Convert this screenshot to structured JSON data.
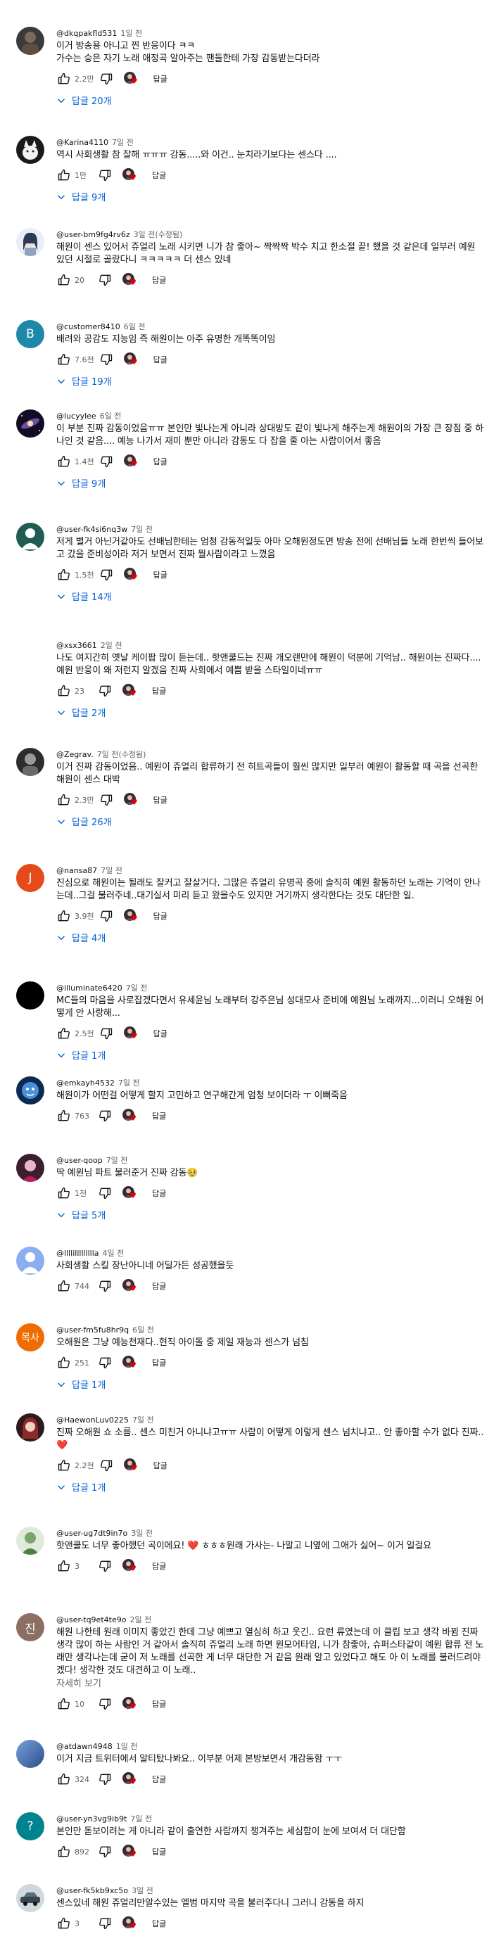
{
  "ui": {
    "reply_label": "답글",
    "read_more_label": "자세히 보기",
    "heart_glyph": "♥",
    "accent_color": "#065fd4",
    "heart_color": "#e00000"
  },
  "comments": [
    {
      "author": "@dkqpakfld531",
      "time": "1일 전",
      "text": "이거 방송용 아니고 찐 반응이다 ㅋㅋ\n가수는 승은 자기 노래 애정곡 알아주는 팬들한테 가장 감동받는다더라",
      "likes": "2.2만",
      "replies": "답글 20개",
      "avatar": "img:dark-photo"
    },
    {
      "author": "@Karina4110",
      "time": "7일 전",
      "text": "역시 사회생활 참 잘해 ㅠㅠㅠ 감동.....와 이건.. 눈치라기보다는 센스다 ....",
      "likes": "1만",
      "replies": "답글 9개",
      "avatar": "img:white-cat"
    },
    {
      "author": "@user-bm9fg4rv6z",
      "time": "3일 전(수정됨)",
      "text": "해원이 센스 있어서 쥬얼리 노래 시키면 니가 참 좋아~ 짝짝짝 박수 치고 한소절 끝! 했을 것 같은데 일부러 예원 있던 시절로 골랐다니 ㅋㅋㅋㅋㅋ 더 센스 있네",
      "likes": "20",
      "replies": "",
      "avatar": "img:anime-girl"
    },
    {
      "author": "@customer8410",
      "time": "6일 전",
      "text": "배려와 공감도 지능임 즉 해원이는 아주 유명한 개똑똑이임",
      "likes": "7.6천",
      "replies": "답글 19개",
      "avatar": "letter:B:#1e88a8"
    },
    {
      "author": "@lucyylee",
      "time": "6일 전",
      "text": "이 부분 진짜 감동이었음ㅠㅠ 본인만 빛나는게 아니라 상대방도 같이 빛나게 해주는게 해원이의 가장 큰 장점 중 하나인 것 같음.... 예능 나가서 재미 뿐만 아니라 감동도 다 잡을 줄 아는 사람이어서 좋음",
      "likes": "1.4천",
      "replies": "답글 9개",
      "avatar": "img:galaxy"
    },
    {
      "author": "@user-fk4si6nq3w",
      "time": "7일 전",
      "text": "저게 별거 아닌거같아도 선배님한테는 엄청 감동적일듯 아마 오해원정도면 방송 전에 선배님들 노래 한번씩 들어보고 갔을 준비성이라 저거 보면서 진짜 뭘사람이라고 느꼈음",
      "likes": "1.5천",
      "replies": "답글 14개",
      "avatar": "img:teal-person"
    },
    {
      "author": "@xsx3661",
      "time": "2일 전",
      "text": "나도 여지간히 옛날 케이팝 많이 듣는데.. 핫앤쿨드는 진짜 개오랜만에 해원이 덕분에 기억남.. 해원이는 진짜다.... 예원 반응이 왜 저런지 알겠음 진짜 사회에서 예쁨 받을 스타일이네ㅠㅠ",
      "likes": "23",
      "replies": "답글 2개",
      "avatar": "none"
    },
    {
      "author": "@Zegrav.",
      "time": "7일 전(수정됨)",
      "text": "이거 진짜 감동이었음.. 예원이 쥬얼리 합류하기 전 히트곡들이 훨씬 많지만 일부러 예원이 활동할 때 곡을 선곡한 해원이 센스 대박",
      "likes": "2.3만",
      "replies": "답글 26개",
      "avatar": "img:bw-figure"
    },
    {
      "author": "@nansa87",
      "time": "7일 전",
      "text": "진심으로 해원이는 될래도 잘커고 잘살거다. 그많은 쥬얼리 유명곡 중에 솔직히 예원 활동하던 노래는 기억이 안나는데..그걸 불러주네..대기실서 미리 듣고 왔을수도 있지만 거기까지 생각한다는 것도 대단한 일.",
      "likes": "3.9천",
      "replies": "답글 4개",
      "avatar": "letter:J:#e64a19"
    },
    {
      "author": "@illuminate6420",
      "time": "7일 전",
      "text": "MC들의 마음을 사로잡겠다면서 유세윤님 노래부터 강주은님 성대모사 준비에 예원님 노래까지...이러니 오해원 어떻게 안 사랑해...",
      "likes": "2.5천",
      "replies": "답글 1개",
      "avatar": "solid:#000000"
    },
    {
      "author": "@emkayh4532",
      "time": "7일 전",
      "text": "해원이가 어떤걸 어떻게 할지 고민하고 연구해간게 엄청 보이더라 ㅜ 이뻐죽음",
      "likes": "763",
      "replies": "",
      "avatar": "img:blue-cartoon"
    },
    {
      "author": "@user-qoop",
      "time": "7일 전",
      "text": "딱 예원님 파트 불러준거 진짜 감동🥹",
      "likes": "1천",
      "replies": "답글 5개",
      "avatar": "img:pink-person"
    },
    {
      "author": "@llllillllllllla",
      "time": "4일 전",
      "text": "사회생활 스킬 장난아니네 어딜가든 성공했을듯",
      "likes": "744",
      "replies": "",
      "avatar": "default"
    },
    {
      "author": "@user-fm5fu8hr9q",
      "time": "6일 전",
      "text": "오해원은 그냥 예능천재다..현직 아이돌 중 제일 재능과 센스가 넘침",
      "likes": "251",
      "replies": "답글 1개",
      "avatar": "letter:목사:#ef6c00"
    },
    {
      "author": "@HaewonLuv0225",
      "time": "7일 전",
      "text": "진짜 오해원 쇼 소름.. 센스 미친거 아니냐고ㅠㅠ 사람이 어떻게 이렇게 센스 넘치냐고.. 안 좋아할 수가 없다 진짜.. ❤️",
      "likes": "2.2천",
      "replies": "답글 1개",
      "avatar": "img:red-hair"
    },
    {
      "author": "@user-ug7dt9in7o",
      "time": "3일 전",
      "text": "핫앤쿨도 너무 좋아했던 곡이에요! ❤️ ㅎㅎㅎ원래 가사는- 나말고 니옆에 그애가 싫어~ 이거 일걸요",
      "likes": "3",
      "replies": "",
      "avatar": "img:green-person"
    },
    {
      "author": "@user-tq9et4te9o",
      "time": "2일 전",
      "text": "해원 나한테 원래 이미지 좋았긴 한데 그냥 예쁘고 열심히 하고 웃긴.. 요런 류였는데 이 클립 보고 생각 바뀜 진짜 생각 많이 하는 사람인 거 같아서 솔직히 쥬얼리 노래 하면 원모어타임, 니가 참좋아, 슈퍼스타같이 예원 합류 전 노래만 생각나는데 굳이 저 노래를 선곡한 게 너무 대단한 거 같음 원래 알고 있었다고 해도 아 이 노래를 불러드려야겠다! 생각한 것도 대견하고 이 노래..",
      "likes": "10",
      "replies": "",
      "read_more": true,
      "avatar": "letter:진:#8d6e63"
    },
    {
      "author": "@atdawn4948",
      "time": "1일 전",
      "text": "이거 지금 트위터에서 알티탔나봐요.. 이부분 어제 본방보면서 개감동함 ㅜㅜ",
      "likes": "324",
      "replies": "",
      "avatar": "img:blue-gradient"
    },
    {
      "author": "@user-yn3vg9ib9t",
      "time": "7일 전",
      "text": "본인만 돋보이려는 게 아니라 같이 출연한 사람까지 챙겨주는 세심함이 눈에 보여서 더 대단함",
      "likes": "892",
      "replies": "",
      "avatar": "letter:?:#00838f"
    },
    {
      "author": "@user-fk5kb9xc5o",
      "time": "3일 전",
      "text": "센스있네 해원 쥬얼리만알수있는 엘범 마지막 곡을 불러주다니 그러니 감동을 하지",
      "likes": "3",
      "replies": "",
      "avatar": "img:car"
    }
  ]
}
